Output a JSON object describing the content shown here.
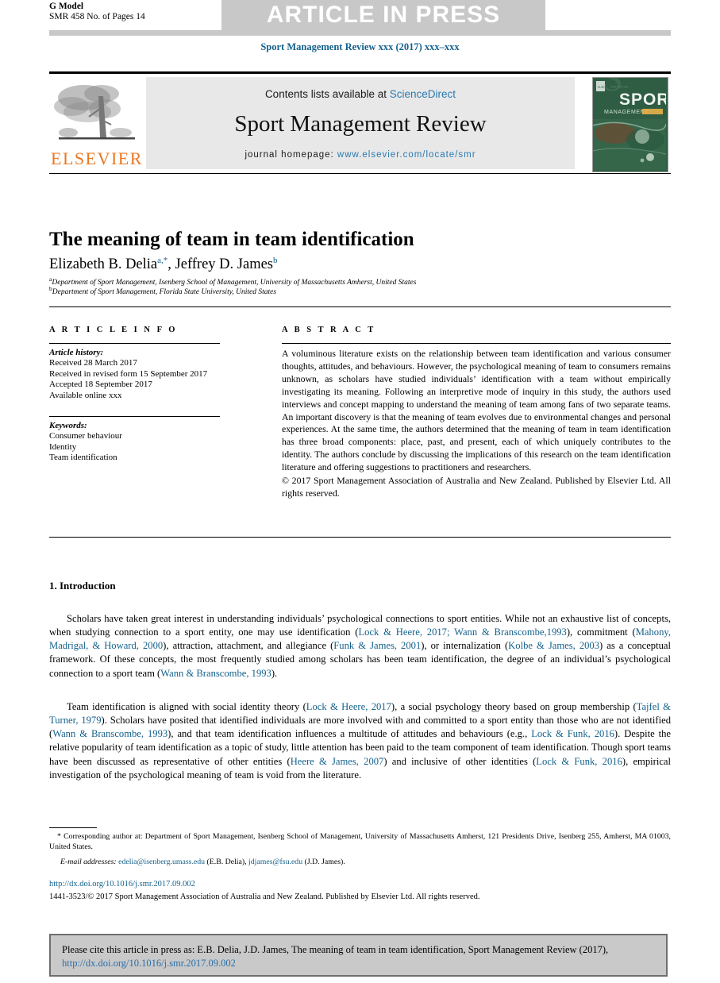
{
  "header": {
    "g_model_line1": "G Model",
    "g_model_line2": "SMR 458 No. of Pages 14",
    "banner": "ARTICLE IN PRESS",
    "journal_running_head": "Sport Management Review xxx (2017) xxx–xxx"
  },
  "masthead": {
    "contents_prefix": "Contents lists available at ",
    "contents_link": "ScienceDirect",
    "journal_title": "Sport Management Review",
    "homepage_prefix": "journal homepage: ",
    "homepage_link": "www.elsevier.com/locate/smr",
    "publisher_name": "ELSEVIER",
    "cover_word_1": "SPORT",
    "cover_word_2": "MANAGEMENT REVIEW"
  },
  "article": {
    "title": "The meaning of team in team identification",
    "authors_plain": "Elizabeth B. Delia, Jeffrey D. James",
    "author1_name": "Elizabeth B. Delia",
    "author1_sup": "a,*",
    "author2_name": "Jeffrey D. James",
    "author2_sup": "b",
    "affiliation_a_marker": "a",
    "affiliation_a": "Department of Sport Management, Isenberg School of Management, University of Massachusetts Amherst, United States",
    "affiliation_b_marker": "b",
    "affiliation_b": "Department of Sport Management, Florida State University, United States"
  },
  "info": {
    "info_heading": "A R T I C L E   I N F O",
    "history_label": "Article history:",
    "history": [
      "Received 28 March 2017",
      "Received in revised form 15 September 2017",
      "Accepted 18 September 2017",
      "Available online xxx"
    ],
    "keywords_label": "Keywords:",
    "keywords": [
      "Consumer behaviour",
      "Identity",
      "Team identification"
    ]
  },
  "abstract": {
    "abstract_heading": "A B S T R A C T",
    "body": "A voluminous literature exists on the relationship between team identification and various consumer thoughts, attitudes, and behaviours. However, the psychological meaning of team to consumers remains unknown, as scholars have studied individuals’ identification with a team without empirically investigating its meaning. Following an interpretive mode of inquiry in this study, the authors used interviews and concept mapping to understand the meaning of team among fans of two separate teams. An important discovery is that the meaning of team evolves due to environmental changes and personal experiences. At the same time, the authors determined that the meaning of team in team identification has three broad components: place, past, and present, each of which uniquely contributes to the identity. The authors conclude by discussing the implications of this research on the team identification literature and offering suggestions to practitioners and researchers.",
    "copyright": "© 2017 Sport Management Association of Australia and New Zealand. Published by Elsevier Ltd. All rights reserved."
  },
  "introduction": {
    "section_title": "1. Introduction",
    "paragraph1_parts": [
      {
        "t": "Scholars have taken great interest in understanding individuals’ psychological connections to sport entities. While not an exhaustive list of concepts, when studying connection to a sport entity, one may use identification (",
        "link": false
      },
      {
        "t": "Lock & Heere, 2017; Wann & Branscombe,1993",
        "link": true
      },
      {
        "t": "), commitment (",
        "link": false
      },
      {
        "t": "Mahony, Madrigal, & Howard, 2000",
        "link": true
      },
      {
        "t": "), attraction, attachment, and allegiance (",
        "link": false
      },
      {
        "t": "Funk & James, 2001",
        "link": true
      },
      {
        "t": "), or internalization (",
        "link": false
      },
      {
        "t": "Kolbe & James, 2003",
        "link": true
      },
      {
        "t": ") as a conceptual framework. Of these concepts, the most frequently studied among scholars has been team identification, the degree of an individual’s psychological connection to a sport team (",
        "link": false
      },
      {
        "t": "Wann & Branscombe, 1993",
        "link": true
      },
      {
        "t": ").",
        "link": false
      }
    ],
    "paragraph2_parts": [
      {
        "t": "Team identification is aligned with social identity theory (",
        "link": false
      },
      {
        "t": "Lock & Heere, 2017",
        "link": true
      },
      {
        "t": "), a social psychology theory based on group membership (",
        "link": false
      },
      {
        "t": "Tajfel & Turner, 1979",
        "link": true
      },
      {
        "t": "). Scholars have posited that identified individuals are more involved with and committed to a sport entity than those who are not identified (",
        "link": false
      },
      {
        "t": "Wann & Branscombe, 1993",
        "link": true
      },
      {
        "t": "), and that team identification influences a multitude of attitudes and behaviours (e.g., ",
        "link": false
      },
      {
        "t": "Lock & Funk, 2016",
        "link": true
      },
      {
        "t": "). Despite the relative popularity of team identification as a topic of study, little attention has been paid to the team component of team identification. Though sport teams have been discussed as representative of other entities (",
        "link": false
      },
      {
        "t": "Heere & James, 2007",
        "link": true
      },
      {
        "t": ") and inclusive of other identities (",
        "link": false
      },
      {
        "t": "Lock & Funk, 2016",
        "link": true
      },
      {
        "t": "), empirical investigation of the psychological meaning of team is void from the literature.",
        "link": false
      }
    ]
  },
  "footnotes": {
    "corresponding_marker": "*",
    "corresponding": "Corresponding author at: Department of Sport Management, Isenberg School of Management, University of Massachusetts Amherst, 121 Presidents Drive, Isenberg 255, Amherst, MA 01003, United States.",
    "email_label": "E-mail addresses:",
    "email1": "edelia@isenberg.umass.edu",
    "email1_owner": "(E.B. Delia),",
    "email2": "jdjames@fsu.edu",
    "email2_owner": "(J.D. James).",
    "doi": "http://dx.doi.org/10.1016/j.smr.2017.09.002",
    "issn_copyright": "1441-3523/© 2017 Sport Management Association of Australia and New Zealand. Published by Elsevier Ltd. All rights reserved."
  },
  "cite_box": {
    "text_before_link": "Please cite this article in press as: E.B. Delia, J.D. James, The meaning of team in team identification, Sport Management Review (2017), ",
    "link": "http://dx.doi.org/10.1016/j.smr.2017.09.002"
  },
  "colors": {
    "link_blue": "#14618c",
    "sciencedirect_blue": "#2a7ab0",
    "elsevier_orange": "#e87722",
    "banner_grey": "#c8c8c8",
    "masthead_grey": "#e8e8e8",
    "cite_box_grey": "#c9c9c9",
    "cover_green": "#2f5d43"
  }
}
